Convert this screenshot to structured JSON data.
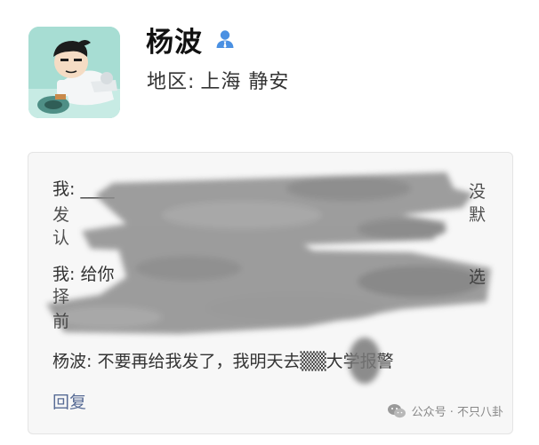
{
  "profile": {
    "name": "杨波",
    "region_label": "地区:",
    "region_value": "上海 静安"
  },
  "messages": [
    {
      "text": "我: ____"
    },
    {
      "text": "我: 给你"
    },
    {
      "text": "杨波: 不要再给我发了，我明天去▒▒大学报警"
    }
  ],
  "reply_label": "回复",
  "watermark": "公众号 · 不只八卦",
  "colors": {
    "link": "#576b95",
    "contact_icon": "#4a90e2",
    "avatar_bg": "#9fd9cf"
  },
  "icons": {
    "contact": "person-icon",
    "watermark": "wechat-icon"
  }
}
